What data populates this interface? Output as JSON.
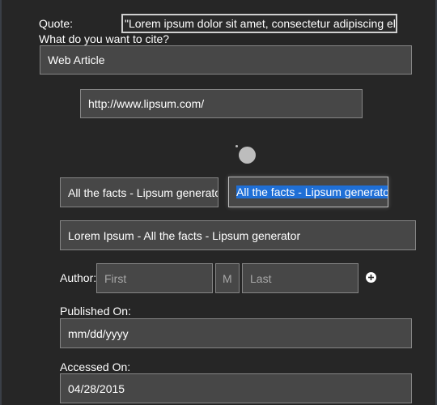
{
  "quote": {
    "label": "Quote:",
    "value": "\"Lorem ipsum dolor sit amet, consectetur adipiscing elit.\""
  },
  "cite": {
    "label": "What do you want to cite?",
    "type_value": "Web Article"
  },
  "url": {
    "value": "http://www.lipsum.com/"
  },
  "title_options": {
    "left_value": "All the facts - Lipsum generator",
    "right_value": "All the facts - Lipsum generator"
  },
  "full_title": {
    "value": "Lorem Ipsum - All the facts - Lipsum generator"
  },
  "author": {
    "label": "Author:",
    "first_placeholder": "First",
    "middle_placeholder": "M",
    "last_placeholder": "Last",
    "add_icon": "plus-circle-icon"
  },
  "published": {
    "label": "Published On:",
    "value": "mm/dd/yyyy"
  },
  "accessed": {
    "label": "Accessed On:",
    "value": "04/28/2015"
  },
  "colors": {
    "background": "#262626",
    "field_bg": "#474747",
    "selection": "#1f6fd6"
  }
}
